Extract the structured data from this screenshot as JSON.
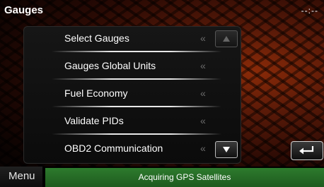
{
  "header": {
    "title": "Gauges",
    "clock": "--:--"
  },
  "menu_items": [
    {
      "label": "Select Gauges",
      "chevron": "«"
    },
    {
      "label": "Gauges Global Units",
      "chevron": "«"
    },
    {
      "label": "Fuel Economy",
      "chevron": "«"
    },
    {
      "label": "Validate PIDs",
      "chevron": "«"
    },
    {
      "label": "OBD2 Communication",
      "chevron": "«"
    }
  ],
  "bottom_bar": {
    "menu_label": "Menu",
    "status_text": "Acquiring GPS Satellites"
  },
  "icons": {
    "scroll_up": "triangle-up-icon",
    "scroll_down": "triangle-down-icon",
    "back": "back-arrow-icon"
  },
  "colors": {
    "status_bar": "#2d7b2d",
    "chevron": "#6c6c6c"
  }
}
